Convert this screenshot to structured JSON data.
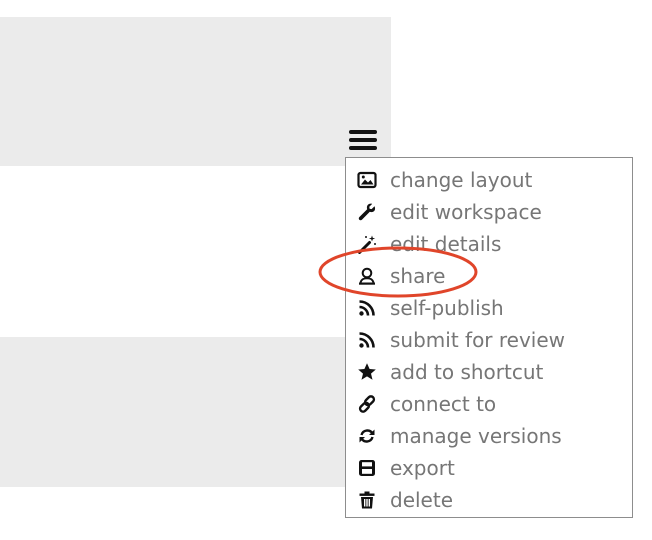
{
  "menu": {
    "items": [
      {
        "label": "change layout",
        "icon": "image-icon"
      },
      {
        "label": "edit workspace",
        "icon": "wrench-icon"
      },
      {
        "label": "edit details",
        "icon": "magic-wand-icon"
      },
      {
        "label": "share",
        "icon": "user-share-icon"
      },
      {
        "label": "self-publish",
        "icon": "rss-icon"
      },
      {
        "label": "submit for review",
        "icon": "rss-icon"
      },
      {
        "label": "add to shortcut",
        "icon": "star-icon"
      },
      {
        "label": "connect to",
        "icon": "link-icon"
      },
      {
        "label": "manage versions",
        "icon": "sync-icon"
      },
      {
        "label": "export",
        "icon": "save-icon"
      },
      {
        "label": "delete",
        "icon": "trash-icon"
      }
    ]
  },
  "colors": {
    "menu_text": "#767676",
    "icon": "#111111",
    "highlight_ring": "#e0452a",
    "panel_gray": "#ebebeb",
    "menu_border": "#8d8d8d"
  },
  "annotation": {
    "highlighted_item": "share"
  }
}
